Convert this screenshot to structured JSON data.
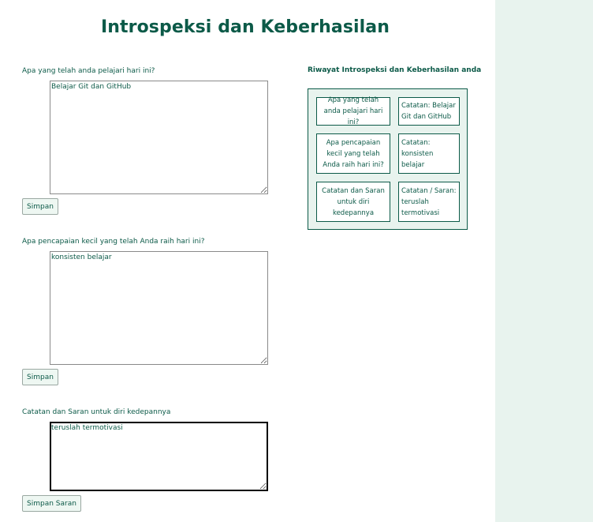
{
  "page": {
    "title": "Introspeksi dan Keberhasilan"
  },
  "form": {
    "q1_label": "Apa yang telah anda pelajari hari ini?",
    "q1_value": "Belajar Git dan GitHub",
    "q1_button": "Simpan",
    "q2_label": "Apa pencapaian kecil yang telah Anda raih hari ini?",
    "q2_value": "konsisten belajar",
    "q2_button": "Simpan",
    "q3_label": "Catatan dan Saran untuk diri kedepannya",
    "q3_value": "teruslah termotivasi",
    "q3_button": "Simpan Saran"
  },
  "history": {
    "title": "Riwayat Introspeksi dan Keberhasilan anda",
    "rows": [
      {
        "question": "Apa yang telah anda pelajari hari ini?",
        "answer": "Catatan: Belajar Git dan GitHub"
      },
      {
        "question": "Apa pencapaian kecil yang telah Anda raih hari ini?",
        "answer": "Catatan: konsisten belajar"
      },
      {
        "question": "Catatan dan Saran untuk diri kedepannya",
        "answer": "Catatan / Saran: teruslah termotivasi"
      }
    ]
  },
  "colors": {
    "primary": "#0c5a48",
    "panel_bg": "#e8f3ee"
  }
}
